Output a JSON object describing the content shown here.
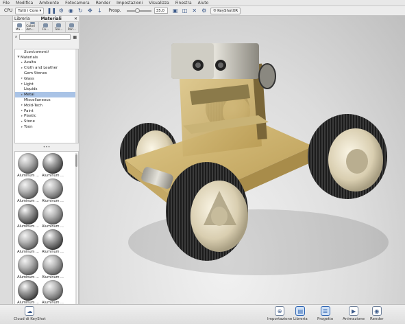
{
  "menubar": {
    "items": [
      "File",
      "Modifica",
      "Ambiente",
      "Fotocamera",
      "Render",
      "Impostazioni",
      "Visualizza",
      "Finestra",
      "Aiuto"
    ]
  },
  "toolbar": {
    "cpu_label": "CPU",
    "cpu_mode": "Tutti i Core",
    "perspective_label": "Prosp.",
    "perspective_value": "35,0",
    "keyshotxr_label": "KeyShotXR"
  },
  "library": {
    "tab_library": "Libreria",
    "tab_materials": "Materiali",
    "categories": [
      "Ma...",
      "Colori Am...",
      "Fo...",
      "Tex...",
      "Pan..."
    ],
    "tree": [
      {
        "label": "Scaricamenti",
        "indent": 1,
        "twisty": "",
        "italic": true
      },
      {
        "label": "Materials",
        "indent": 0,
        "twisty": "▼"
      },
      {
        "label": "Axalta",
        "indent": 1,
        "twisty": "▸"
      },
      {
        "label": "Cloth and Leather",
        "indent": 1,
        "twisty": "▸"
      },
      {
        "label": "Gem Stones",
        "indent": 1,
        "twisty": ""
      },
      {
        "label": "Glass",
        "indent": 1,
        "twisty": "▸"
      },
      {
        "label": "Light",
        "indent": 1,
        "twisty": "▸"
      },
      {
        "label": "Liquids",
        "indent": 1,
        "twisty": ""
      },
      {
        "label": "Metal",
        "indent": 1,
        "twisty": "▸",
        "selected": true
      },
      {
        "label": "Miscellaneous",
        "indent": 1,
        "twisty": ""
      },
      {
        "label": "Mold-Tech",
        "indent": 1,
        "twisty": "▸"
      },
      {
        "label": "Paint",
        "indent": 1,
        "twisty": "▸"
      },
      {
        "label": "Plastic",
        "indent": 1,
        "twisty": "▸"
      },
      {
        "label": "Stone",
        "indent": 1,
        "twisty": "▸"
      },
      {
        "label": "Toon",
        "indent": 1,
        "twisty": "▸"
      }
    ],
    "divider": "•••",
    "thumbnails": [
      "Aluminum ...",
      "Aluminum ...",
      "Aluminum ...",
      "Aluminum ...",
      "Aluminum ...",
      "Aluminum ...",
      "Aluminum ...",
      "Aluminum ...",
      "Aluminum ...",
      "Aluminum ...",
      "Aluminum ...",
      "Aluminum ...",
      "",
      ""
    ],
    "footer_button": "Invia"
  },
  "dock": {
    "cloud_label": "Cloud di KeyShot",
    "items": [
      {
        "label": "Importazione",
        "icon": "import-icon",
        "glyph": "⊕"
      },
      {
        "label": "Libreria",
        "icon": "book-icon",
        "glyph": "▤",
        "active": true
      },
      {
        "label": "Progetto",
        "icon": "project-icon",
        "glyph": "☰",
        "active": true
      },
      {
        "label": "Animazione",
        "icon": "play-icon",
        "glyph": "▶"
      },
      {
        "label": "Render",
        "icon": "render-icon",
        "glyph": "◉"
      }
    ]
  }
}
